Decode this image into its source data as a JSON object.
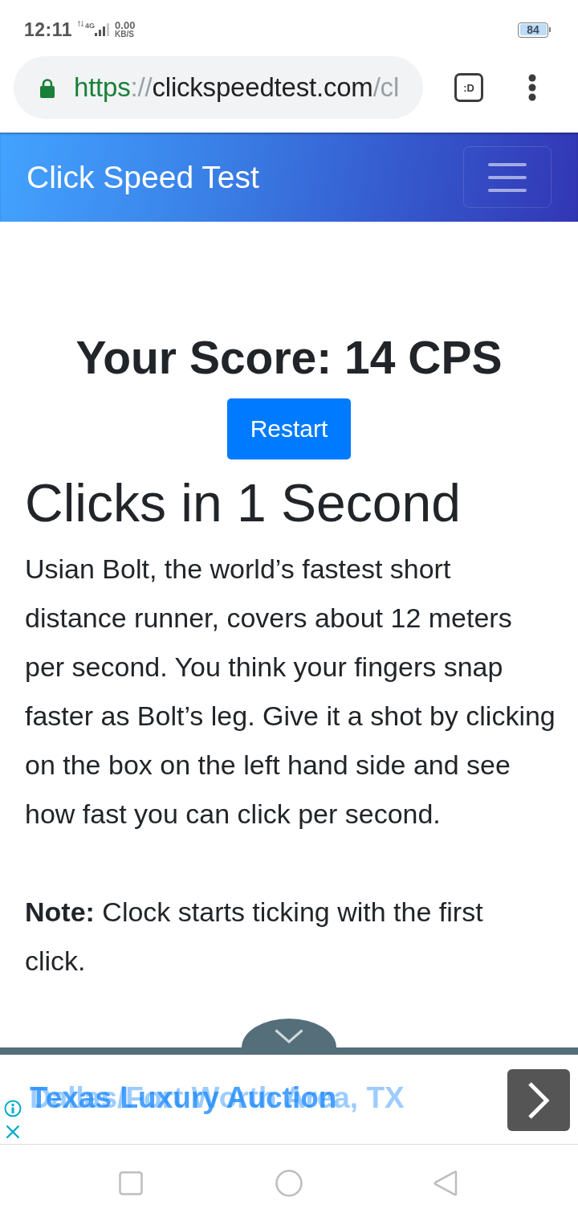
{
  "status_bar": {
    "time": "12:11",
    "network": "4G",
    "speed": "0.00",
    "speed_unit": "KB/S",
    "battery": "84"
  },
  "browser": {
    "url": [
      {
        "text": "https",
        "kind": "scheme"
      },
      {
        "text": "://",
        "kind": "muted"
      },
      {
        "text": "clickspeedtest.com",
        "kind": "host"
      },
      {
        "text": "/cl",
        "kind": "muted"
      }
    ],
    "tab_switcher": ":D"
  },
  "navbar": {
    "title": "Click Speed Test"
  },
  "score": {
    "heading": "Your Score: 14 CPS",
    "button": "Restart"
  },
  "article": {
    "heading": "Clicks in 1 Second",
    "paragraphs": [
      "Usian Bolt, the world’s fastest short distance runner, covers about 12 meters per second. You think your fingers snap faster as Bolt’s leg. Give it a shot by clicking on the box on the left hand side and see how fast you can click per second.",
      "**Note:** Clock starts ticking with the first click."
    ]
  },
  "ad": {
    "headlines": [
      {
        "text": "Dallas/Fort Worth Area, TX",
        "kind": "fading"
      },
      {
        "text": "Texas Luxury Auction",
        "kind": "current"
      }
    ]
  }
}
